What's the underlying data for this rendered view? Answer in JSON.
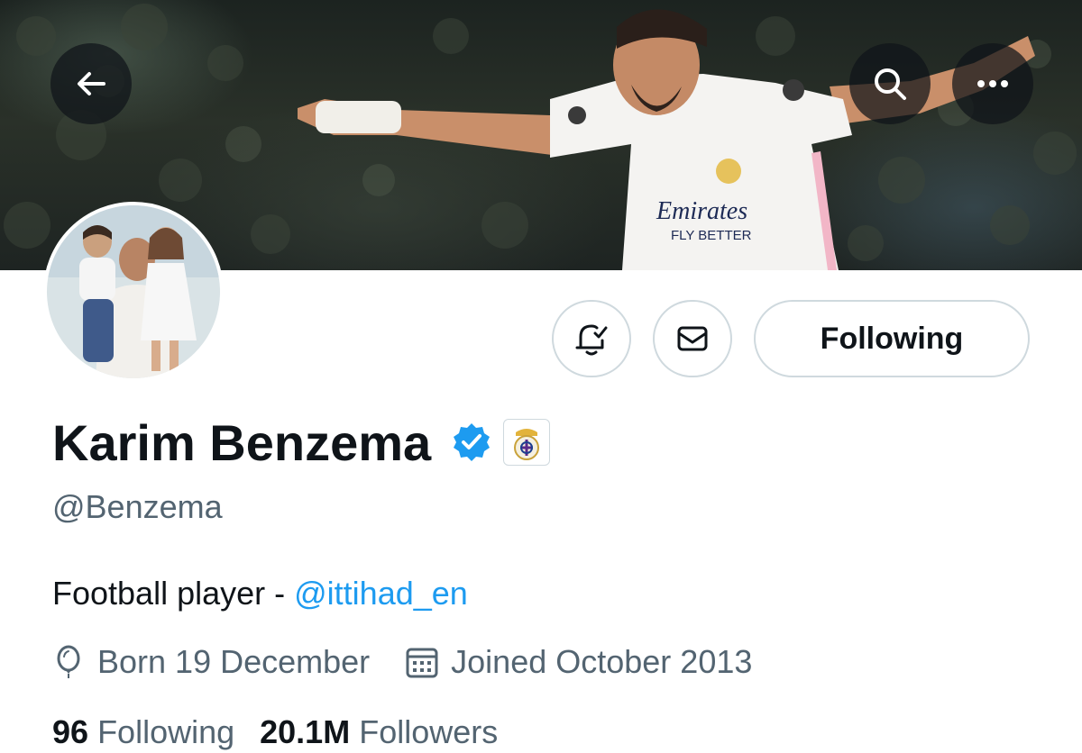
{
  "header": {
    "back_icon": "arrow-left-icon",
    "search_icon": "search-icon",
    "more_icon": "more-horizontal-icon"
  },
  "banner": {
    "jersey_sponsor": "Emirates",
    "jersey_slogan": "FLY BETTER"
  },
  "profile": {
    "display_name": "Karim Benzema",
    "handle": "@Benzema",
    "verified_icon": "verified-badge-icon",
    "affiliation_icon": "club-crest-icon",
    "bio_text": "Football player - ",
    "bio_mention": "@ittihad_en",
    "birthday": "Born 19 December",
    "joined": "Joined October 2013",
    "following_count": "96",
    "following_label": "Following",
    "followers_count": "20.1M",
    "followers_label": "Followers"
  },
  "actions": {
    "notifications_icon": "bell-check-icon",
    "message_icon": "envelope-icon",
    "follow_button_label": "Following"
  },
  "colors": {
    "accent": "#1d9bf0",
    "text_primary": "#0f1419",
    "text_secondary": "#536471",
    "border": "#cfd9de"
  }
}
